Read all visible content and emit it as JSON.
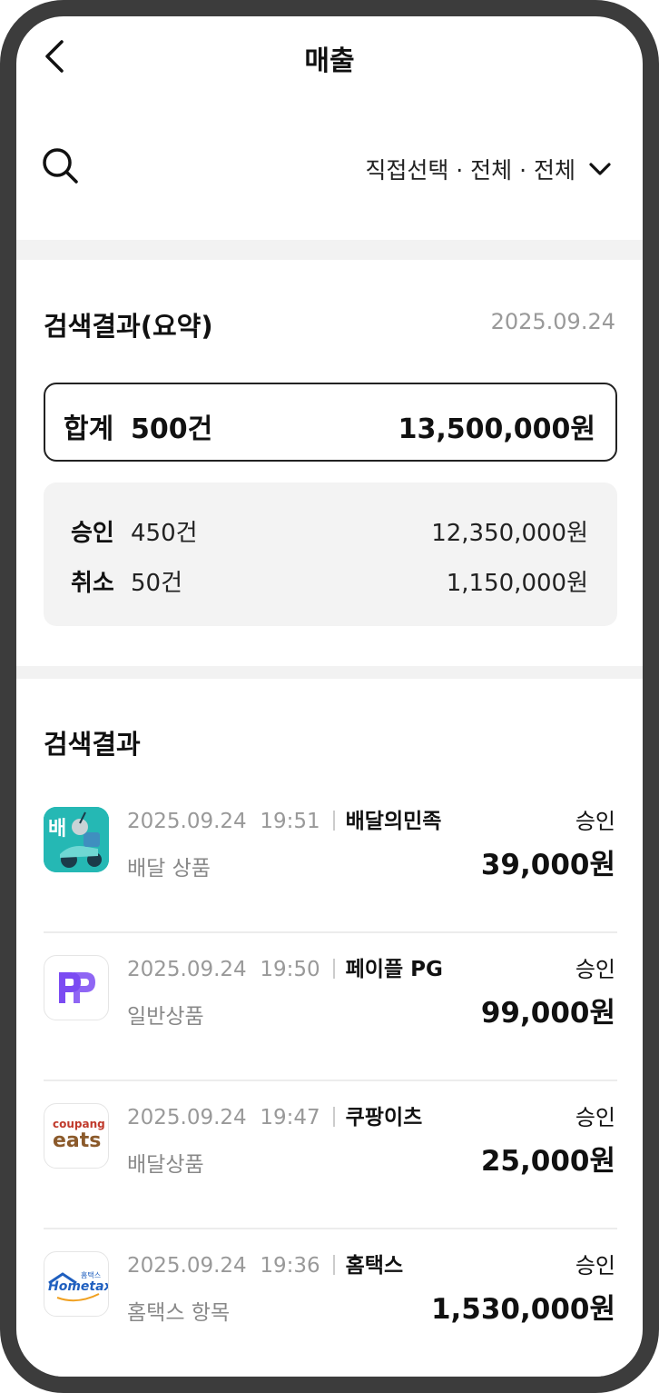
{
  "header": {
    "title": "매출"
  },
  "filter": {
    "label": "직접선택 · 전체 · 전체"
  },
  "summary": {
    "title": "검색결과(요약)",
    "date": "2025.09.24",
    "total": {
      "label": "합계",
      "count": "500건",
      "amount": "13,500,000원"
    },
    "approved": {
      "label": "승인",
      "count": "450건",
      "amount": "12,350,000원"
    },
    "cancelled": {
      "label": "취소",
      "count": "50건",
      "amount": "1,150,000원"
    }
  },
  "results": {
    "title": "검색결과",
    "items": [
      {
        "date": "2025.09.24",
        "time": "19:51",
        "merchant": "배달의민족",
        "desc": "배달 상품",
        "status": "승인",
        "amount": "39,000원",
        "logo": "baemin-logo",
        "logo_text": "배"
      },
      {
        "date": "2025.09.24",
        "time": "19:50",
        "merchant": "페이플 PG",
        "desc": "일반상품",
        "status": "승인",
        "amount": "99,000원",
        "logo": "payple-logo"
      },
      {
        "date": "2025.09.24",
        "time": "19:47",
        "merchant": "쿠팡이츠",
        "desc": "배달상품",
        "status": "승인",
        "amount": "25,000원",
        "logo": "coupang-eats-logo",
        "logo_text": "coupang",
        "logo_text_2": "eats"
      },
      {
        "date": "2025.09.24",
        "time": "19:36",
        "merchant": "홈택스",
        "desc": "홈택스 항목",
        "status": "승인",
        "amount": "1,530,000원",
        "logo": "hometax-logo",
        "logo_text": "홈택스",
        "logo_text_2": "Hometax"
      }
    ]
  },
  "colors": {
    "accent_purple": "#7b4bf2",
    "baemin_teal": "#2ac1bc",
    "coupang_brown": "#8b5a2b",
    "hometax_blue": "#1f5fbf"
  }
}
